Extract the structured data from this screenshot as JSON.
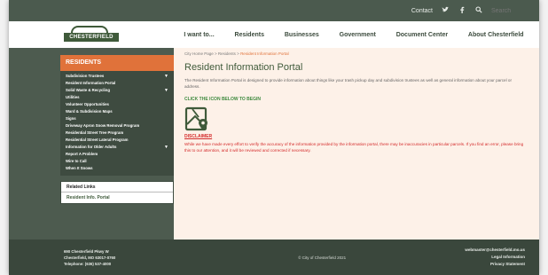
{
  "topbar": {
    "contact": "Contact",
    "twitter_icon": "twitter-icon",
    "facebook_icon": "facebook-icon",
    "search_icon": "search-icon",
    "search_placeholder": "Search"
  },
  "logo": {
    "text": "CHESTERFIELD"
  },
  "nav": {
    "items": [
      {
        "label": "I want to..."
      },
      {
        "label": "Residents"
      },
      {
        "label": "Businesses"
      },
      {
        "label": "Government"
      },
      {
        "label": "Document Center"
      },
      {
        "label": "About Chesterfield"
      }
    ]
  },
  "sidebar": {
    "heading": "RESIDENTS",
    "items": [
      {
        "label": "Subdivision Trustees",
        "chevron": "▼"
      },
      {
        "label": "Resident Information Portal",
        "chevron": ""
      },
      {
        "label": "Solid Waste & Recycling",
        "chevron": "▼"
      },
      {
        "label": "Utilities",
        "chevron": ""
      },
      {
        "label": "Volunteer Opportunities",
        "chevron": ""
      },
      {
        "label": "Ward & Subdivision Maps",
        "chevron": ""
      },
      {
        "label": "Signs",
        "chevron": ""
      },
      {
        "label": "Driveway Apron Snow Removal Program",
        "chevron": ""
      },
      {
        "label": "Residential Street Tree Program",
        "chevron": ""
      },
      {
        "label": "Residential Street Lateral Program",
        "chevron": ""
      },
      {
        "label": "Information for Older Adults",
        "chevron": "▼"
      },
      {
        "label": "Report A Problem",
        "chevron": ""
      },
      {
        "label": "Wire to Call",
        "chevron": ""
      },
      {
        "label": "When It Snows",
        "chevron": ""
      }
    ],
    "related_title": "Related Links",
    "related_link": "Resident Info. Portal"
  },
  "main": {
    "breadcrumb": {
      "home": "City Home Page",
      "sep1": " > ",
      "section": "Residents",
      "sep2": " > ",
      "current": "Resident Information Portal"
    },
    "title": "Resident Information Portal",
    "intro": "The Resident Information Portal is designed to provide information about things like your trash pickup day and subdivision trustees as well as general information about your parcel or address.",
    "cta": "CLICK THE ICON BELOW TO BEGIN",
    "map_icon": "map-pin-icon",
    "disclaimer_heading": "DISCLAIMER",
    "disclaimer_text": "While we have made every effort to verify the accuracy of the information provided by the information portal, there may be inaccuracies in particular parcels. If you find an error, please bring this to our attention, and it will be reviewed and corrected if necessary."
  },
  "footer": {
    "address_line1": "690 Chesterfield Pkwy W",
    "address_line2": "Chesterfield, MO 63017-0760",
    "phone": "Telephone: (636) 537-4000",
    "copyright": "© City of Chesterfield 2021",
    "email": "webmaster@chesterfield.mo.us",
    "legal": "Legal Information",
    "privacy": "Privacy Statement"
  },
  "colors": {
    "accent": "#e0723a",
    "brand_green": "#3f5a3a",
    "sidebar_dark": "#3e4b40",
    "disclaimer_red": "#d42a2a",
    "content_bg": "#fdf1e8"
  }
}
